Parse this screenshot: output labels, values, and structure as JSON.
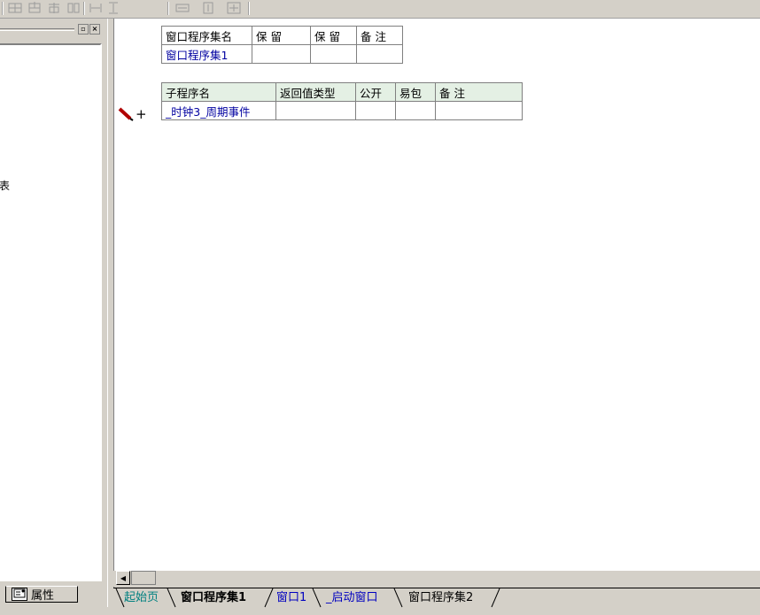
{
  "toolbar": {
    "buttons": [
      "insert-row-icon",
      "insert-col-icon",
      "merge-icon",
      "split-icon",
      "width-icon",
      "height-icon",
      "size-icon",
      "fit-icon",
      "center-icon"
    ]
  },
  "left_panel": {
    "close_glyph": "×",
    "restore_glyph": "▫",
    "fragment_text": "表",
    "tab_label": "属性"
  },
  "set_table": {
    "headers": [
      "窗口程序集名",
      "保 留",
      "保 留",
      "备 注"
    ],
    "rows": [
      [
        "窗口程序集1",
        "",
        "",
        ""
      ]
    ]
  },
  "sub_table": {
    "headers": [
      "子程序名",
      "返回值类型",
      "公开",
      "易包",
      "备 注"
    ],
    "rows": [
      [
        "_时钟3_周期事件",
        "",
        "",
        "",
        ""
      ]
    ]
  },
  "row_marker": "+",
  "scroll": {
    "left_glyph": "◀"
  },
  "bottom_tabs": [
    {
      "label": "起始页",
      "style": "link"
    },
    {
      "label": "窗口程序集1",
      "style": "active"
    },
    {
      "label": "窗口1",
      "style": "blue"
    },
    {
      "label": "_启动窗口",
      "style": "blue"
    },
    {
      "label": "窗口程序集2",
      "style": "plain"
    }
  ],
  "colors": {
    "chrome": "#d4d0c8",
    "subtable_header_bg": "#e4f0e4",
    "link_blue": "#0000a0",
    "start_tab": "#008080",
    "pencil_red": "#b00000"
  }
}
